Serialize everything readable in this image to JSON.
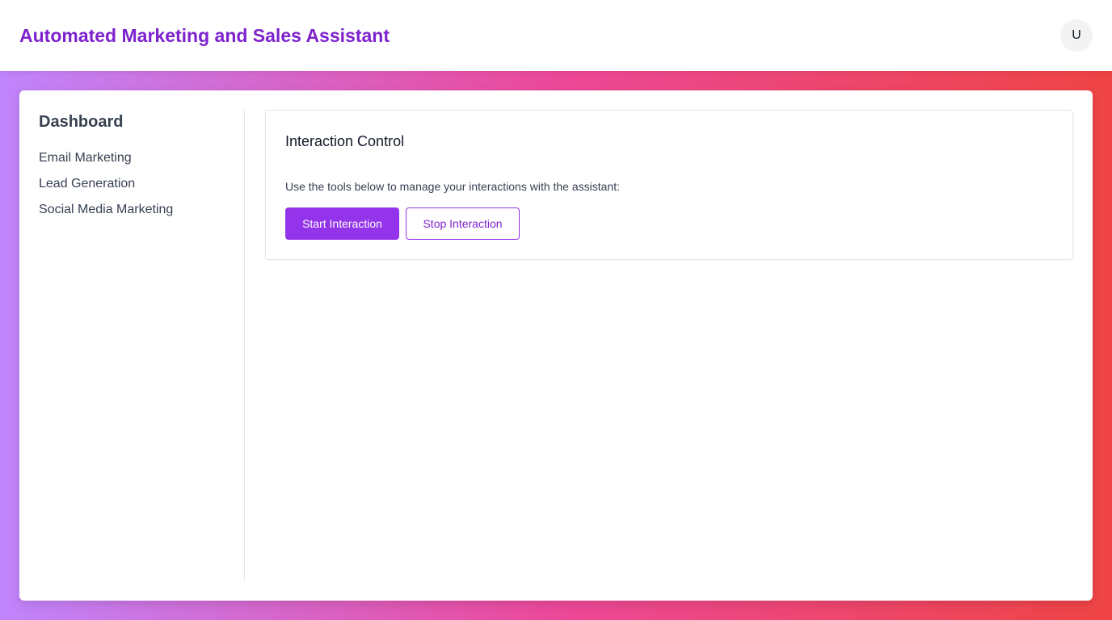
{
  "header": {
    "title": "Automated Marketing and Sales Assistant",
    "avatar_initial": "U"
  },
  "sidebar": {
    "heading": "Dashboard",
    "items": [
      {
        "label": "Email Marketing"
      },
      {
        "label": "Lead Generation"
      },
      {
        "label": "Social Media Marketing"
      }
    ]
  },
  "interaction_card": {
    "title": "Interaction Control",
    "description": "Use the tools below to manage your interactions with the assistant:",
    "start_label": "Start Interaction",
    "stop_label": "Stop Interaction"
  },
  "colors": {
    "accent": "#9333ea",
    "title_text": "#7e22ce",
    "background_gradient": [
      "#c084fc",
      "#ec4899",
      "#ef4444"
    ]
  }
}
